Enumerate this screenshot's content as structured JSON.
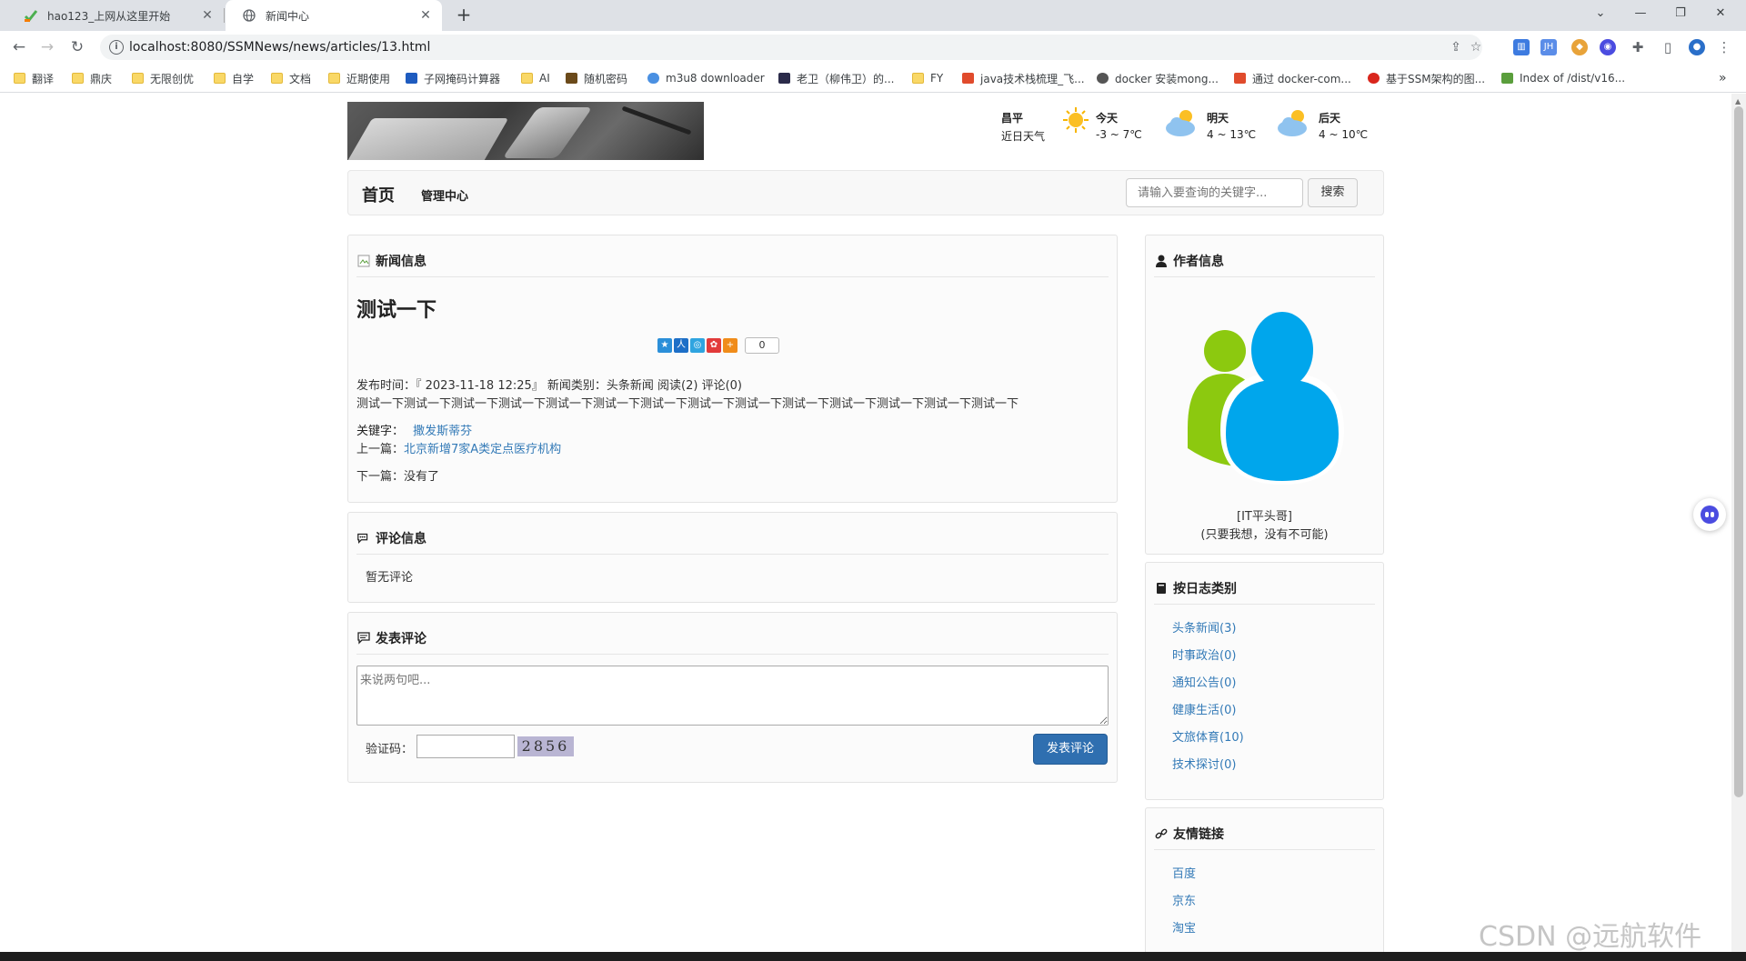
{
  "browser": {
    "tabs": [
      {
        "title": "hao123_上网从这里开始",
        "icon": "hao123-icon"
      },
      {
        "title": "新闻中心",
        "icon": "globe-icon"
      }
    ],
    "url": "localhost:8080/SSMNews/news/articles/13.html",
    "bookmarks": [
      "翻译",
      "鼎庆",
      "无限创优",
      "自学",
      "文档",
      "近期使用",
      "子网掩码计算器",
      "AI",
      "随机密码",
      "m3u8 downloader",
      "老卫（柳伟卫）的...",
      "FY",
      "java技术栈梳理_飞...",
      "docker 安装mong...",
      "通过 docker-com...",
      "基于SSM架构的图...",
      "Index of /dist/v16..."
    ],
    "bookmarks_more": "»"
  },
  "weather": {
    "location": "昌平",
    "subtitle": "近日天气",
    "days": [
      {
        "day": "今天",
        "range": "-3 ~ 7℃",
        "icon": "sun-icon"
      },
      {
        "day": "明天",
        "range": "4 ~ 13℃",
        "icon": "cloud-sun-icon"
      },
      {
        "day": "后天",
        "range": "4 ~ 10℃",
        "icon": "cloud-sun-icon"
      }
    ]
  },
  "nav": {
    "brand": "首页",
    "admin": "管理中心",
    "search_placeholder": "请输入要查询的关键字...",
    "search_button": "搜索"
  },
  "article": {
    "panel_title": "新闻信息",
    "title": "测试一下",
    "share_count": "0",
    "meta": "发布时间：『 2023-11-18 12:25』 新闻类别：头条新闻 阅读(2) 评论(0)",
    "content": "测试一下测试一下测试一下测试一下测试一下测试一下测试一下测试一下测试一下测试一下测试一下测试一下测试一下测试一下",
    "keyword_label": "关键字：",
    "keyword": "撒发斯蒂芬",
    "prev_label": "上一篇：",
    "prev_title": "北京新增7家A类定点医疗机构",
    "next_label": "下一篇：",
    "next_title": "没有了"
  },
  "comments": {
    "panel_title": "评论信息",
    "empty": "暂无评论"
  },
  "post_comment": {
    "panel_title": "发表评论",
    "placeholder": "来说两句吧...",
    "captcha_label": "验证码：",
    "captcha_text": "2856",
    "submit": "发表评论"
  },
  "author": {
    "panel_title": "作者信息",
    "name": "[IT平头哥]",
    "motto": "(只要我想，没有不可能)"
  },
  "categories": {
    "panel_title": "按日志类别",
    "items": [
      "头条新闻(3)",
      "时事政治(0)",
      "通知公告(0)",
      "健康生活(0)",
      "文旅体育(10)",
      "技术探讨(0)"
    ]
  },
  "links": {
    "panel_title": "友情链接",
    "items": [
      "百度",
      "京东",
      "淘宝"
    ]
  },
  "watermark": "CSDN @远航软件"
}
